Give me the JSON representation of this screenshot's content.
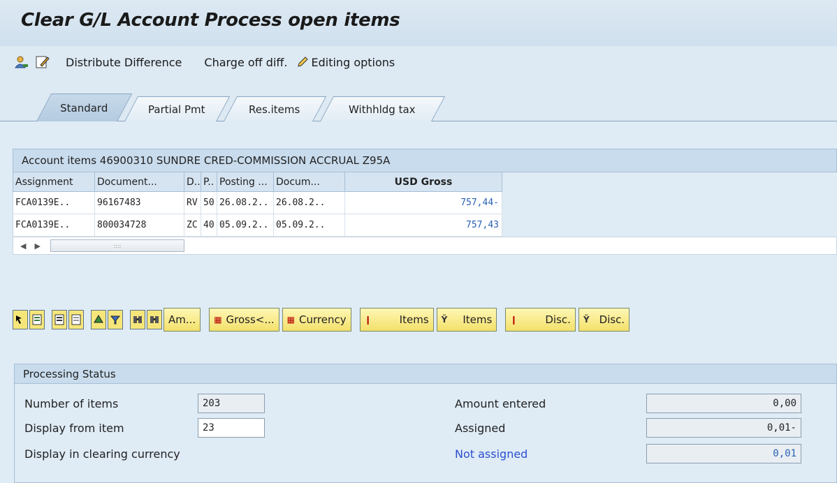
{
  "window": {
    "title": "Clear G/L Account Process open items"
  },
  "toolbar": {
    "distribute_difference": "Distribute Difference",
    "charge_off_diff": "Charge off diff.",
    "editing_options": "Editing options"
  },
  "tabs": [
    {
      "label": "Standard",
      "active": true
    },
    {
      "label": "Partial Pmt",
      "active": false
    },
    {
      "label": "Res.items",
      "active": false
    },
    {
      "label": "Withhldg tax",
      "active": false
    }
  ],
  "grid": {
    "title": "Account items 46900310 SUNDRE CRED-COMMISSION ACCRUAL Z95A",
    "columns": [
      "Assignment",
      "Document...",
      "D..",
      "P..",
      "Posting ...",
      "Docum...",
      "USD Gross"
    ],
    "rows": [
      [
        "FCA0139E..",
        "96167483",
        "RV",
        "50",
        "26.08.2..",
        "26.08.2..",
        "757,44-"
      ],
      [
        "FCA0139E..",
        "800034728",
        "ZC",
        "40",
        "05.09.2..",
        "05.09.2..",
        "757,43"
      ]
    ],
    "scroll_thumb": "::::"
  },
  "buttons": {
    "amount": "Am...",
    "gross": "Gross<...",
    "currency": "Currency",
    "items_1": "Items",
    "items_2": "Items",
    "disc_1": "Disc.",
    "disc_2": "Disc."
  },
  "processing_status": {
    "title": "Processing Status",
    "number_of_items_label": "Number of items",
    "number_of_items": "203",
    "display_from_item_label": "Display from item",
    "display_from_item": "23",
    "display_in_clearing_currency": "Display in clearing currency",
    "amount_entered_label": "Amount entered",
    "amount_entered": "0,00",
    "assigned_label": "Assigned",
    "assigned": "0,01-",
    "not_assigned_label": "Not assigned",
    "not_assigned": "0,01"
  },
  "colors": {
    "accent_blue": "#2a61b5",
    "button_yellow": "#f3e06a",
    "panel_bg": "#dfebf5"
  }
}
